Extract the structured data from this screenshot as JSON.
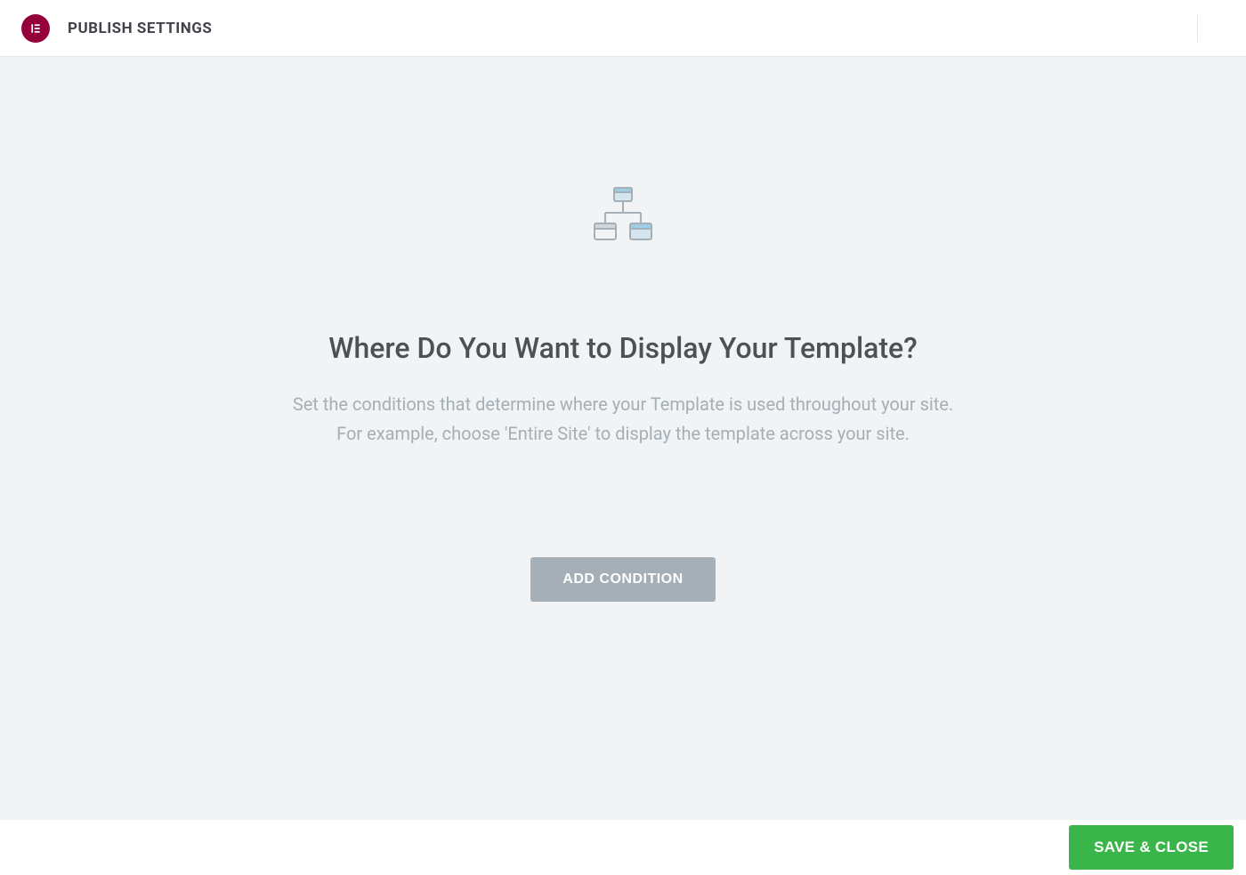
{
  "header": {
    "logo_text": "E",
    "title": "PUBLISH SETTINGS"
  },
  "main": {
    "heading": "Where Do You Want to Display Your Template?",
    "description_line1": "Set the conditions that determine where your Template is used throughout your site.",
    "description_line2": "For example, choose 'Entire Site' to display the template across your site.",
    "add_condition_label": "ADD CONDITION"
  },
  "footer": {
    "save_close_label": "SAVE & CLOSE"
  }
}
